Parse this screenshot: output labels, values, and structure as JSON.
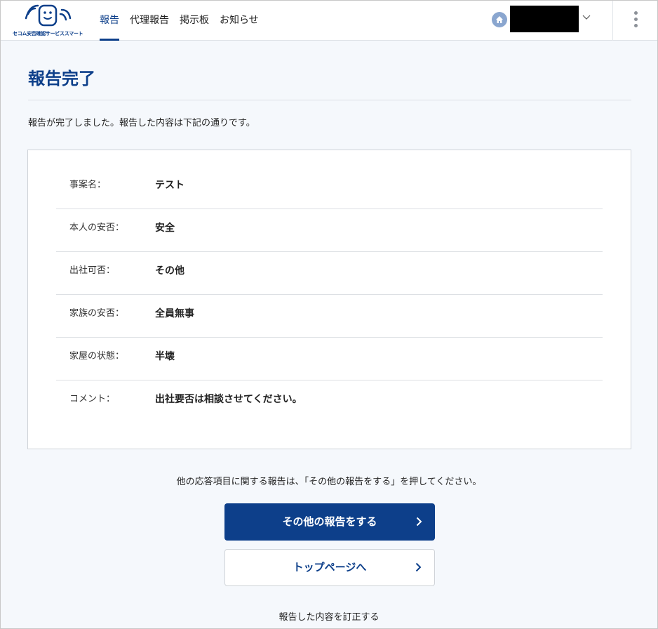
{
  "header": {
    "logo_text": "セコム安否確認サービススマート",
    "nav": [
      "報告",
      "代理報告",
      "掲示板",
      "お知らせ"
    ],
    "active_index": 0,
    "user_name": "",
    "icons": {
      "home": "home-icon",
      "chevron": "chevron-down-icon",
      "menu": "kebab-menu-icon"
    }
  },
  "main": {
    "title": "報告完了",
    "intro": "報告が完了しました。報告した内容は下記の通りです。",
    "rows": [
      {
        "label": "事案名：",
        "value": "テスト"
      },
      {
        "label": "本人の安否：",
        "value": "安全"
      },
      {
        "label": "出社可否：",
        "value": "その他"
      },
      {
        "label": "家族の安否：",
        "value": "全員無事"
      },
      {
        "label": "家屋の状態：",
        "value": "半壊"
      },
      {
        "label": "コメント：",
        "value": "出社要否は相談させてください。"
      }
    ],
    "note": "他の応答項目に関する報告は、「その他の報告をする」を押してください。",
    "primary_button": "その他の報告をする",
    "secondary_button": "トップページへ",
    "correct_link": "報告した内容を訂正する"
  },
  "colors": {
    "brand": "#0d3f8a",
    "background": "#f5f8fc"
  }
}
